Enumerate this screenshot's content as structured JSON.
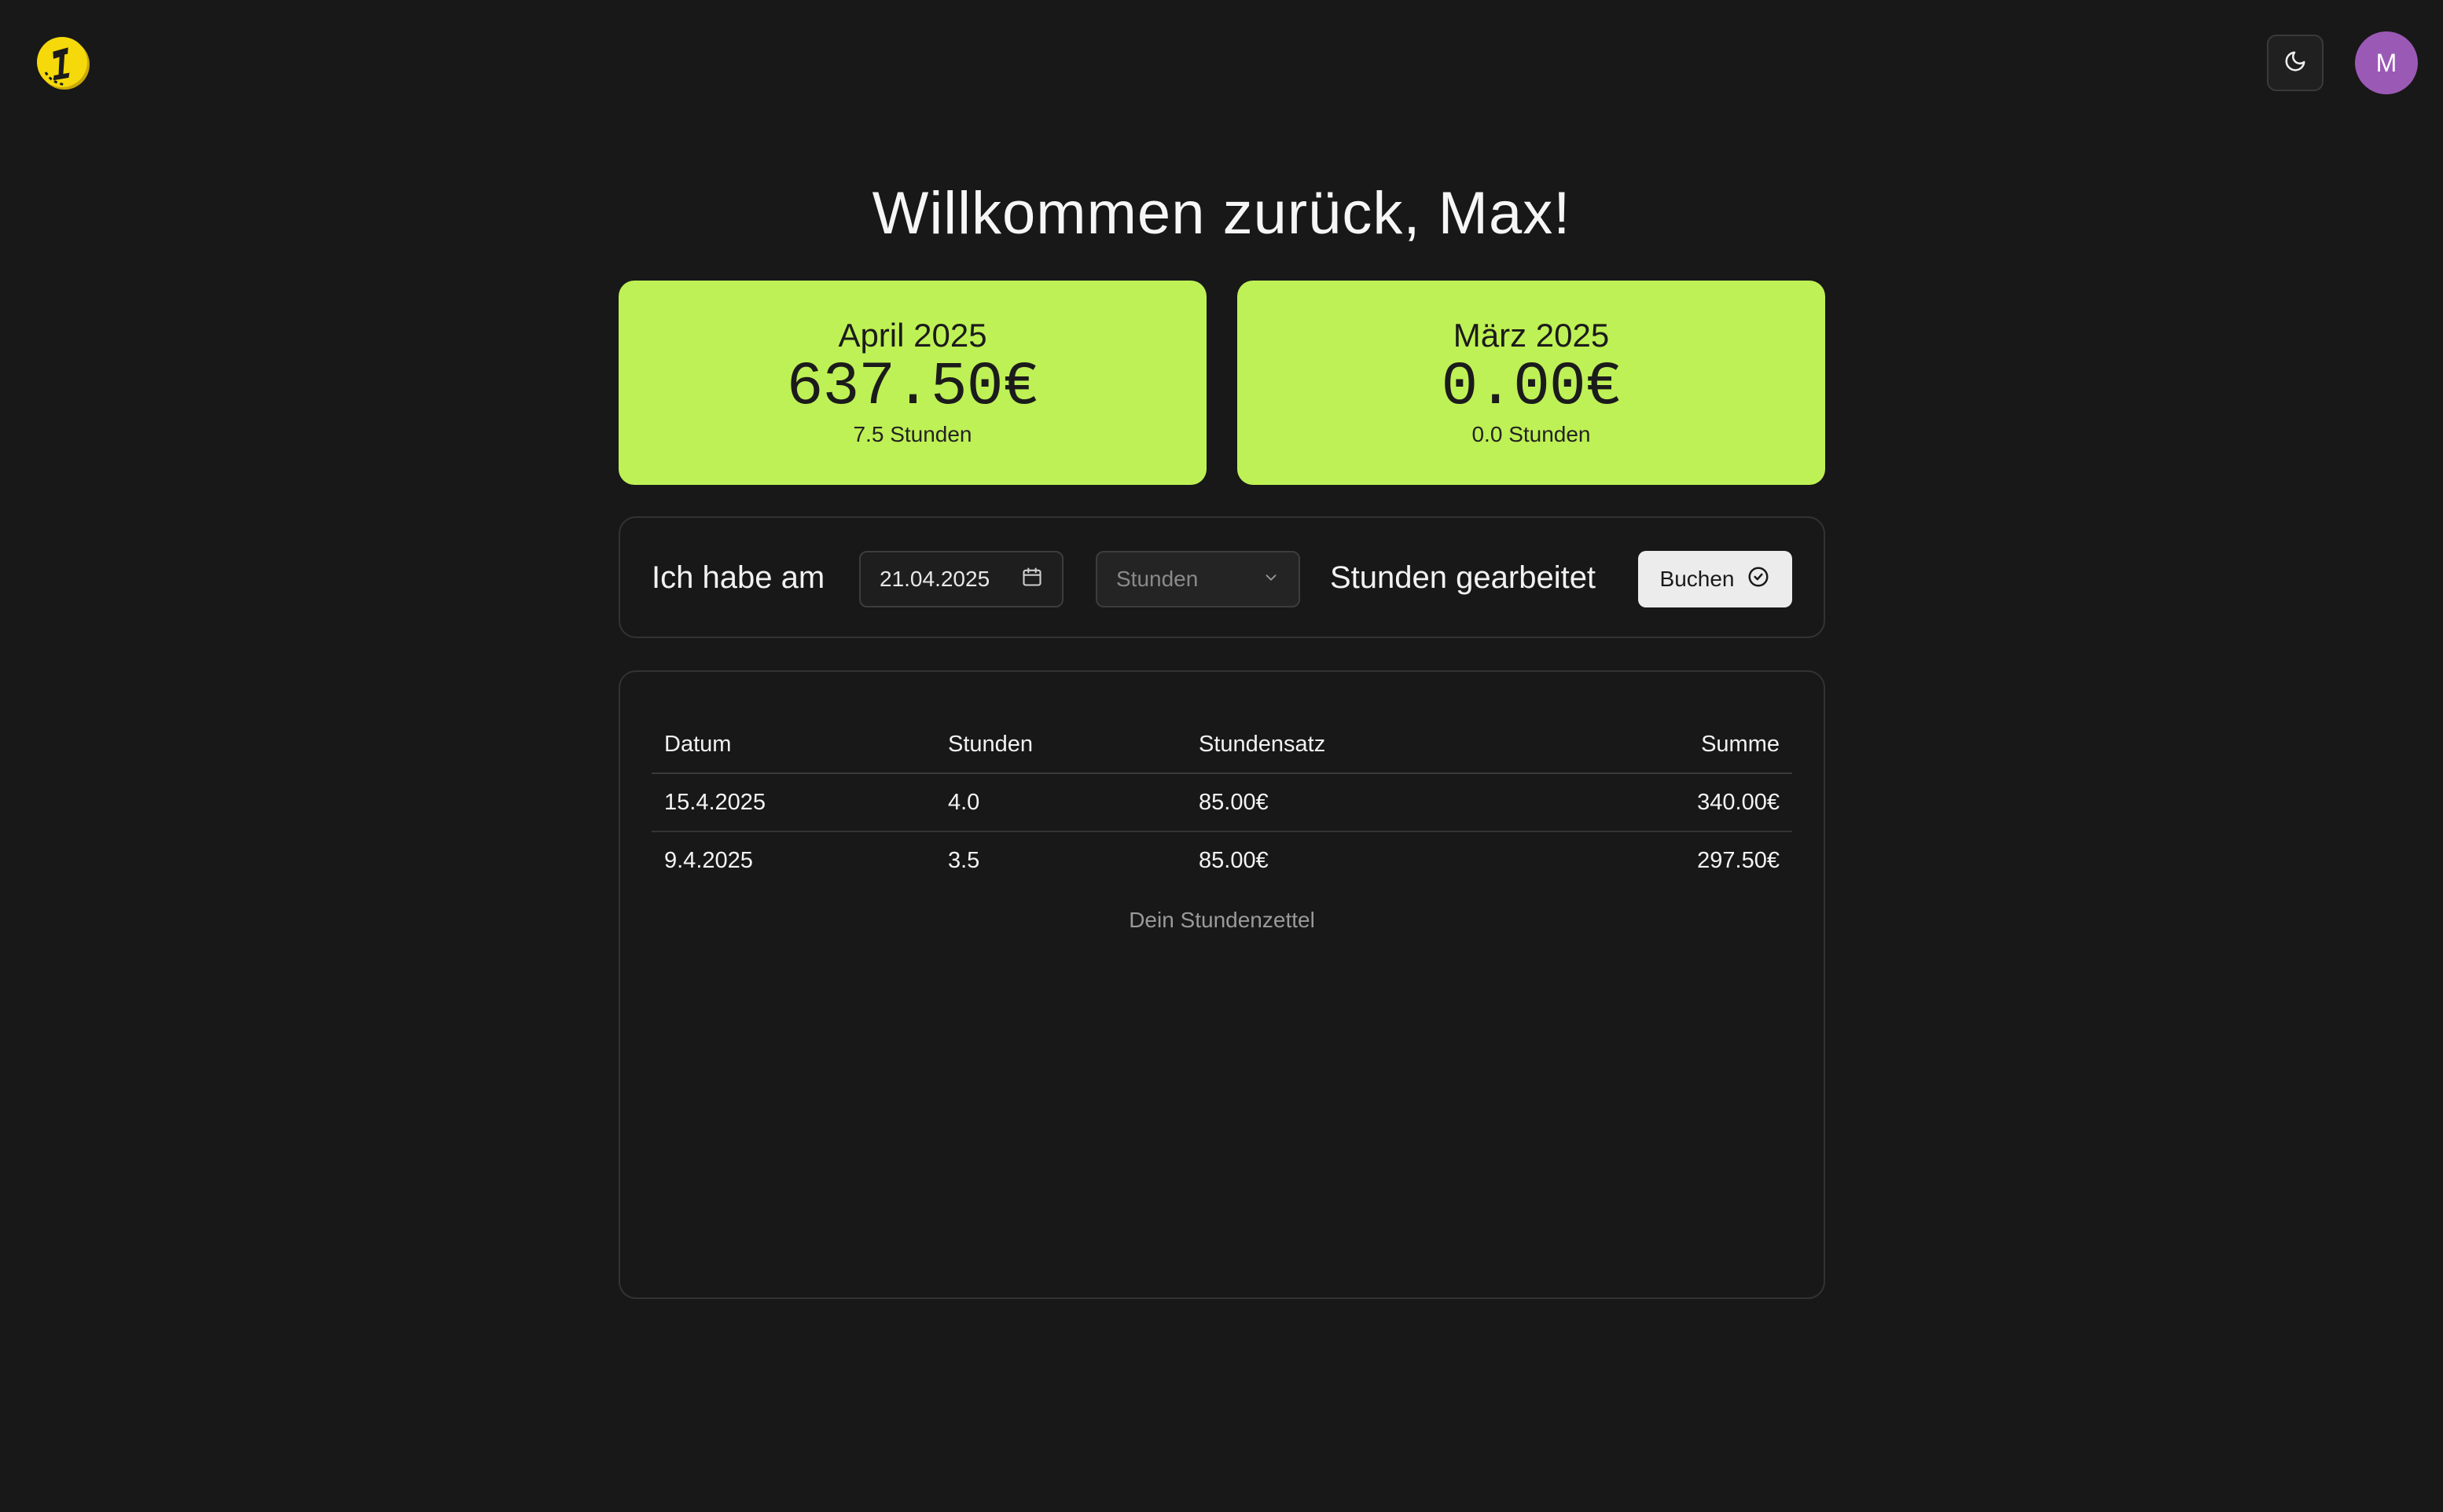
{
  "header": {
    "logo_icon": "coin-logo-icon",
    "theme_icon": "moon-icon",
    "avatar_initial": "M",
    "avatar_color": "#9b59b6"
  },
  "welcome": "Willkommen zurück, Max!",
  "summary": [
    {
      "month": "April 2025",
      "amount": "637.50€",
      "hours": "7.5 Stunden"
    },
    {
      "month": "März 2025",
      "amount": "0.00€",
      "hours": "0.0 Stunden"
    }
  ],
  "entry": {
    "prefix": "Ich habe am",
    "date_value": "21.04.2025",
    "hours_placeholder": "Stunden",
    "suffix": "Stunden gearbeitet",
    "button_label": "Buchen"
  },
  "table": {
    "columns": [
      "Datum",
      "Stunden",
      "Stundensatz",
      "Summe"
    ],
    "rows": [
      [
        "15.4.2025",
        "4.0",
        "85.00€",
        "340.00€"
      ],
      [
        "9.4.2025",
        "3.5",
        "85.00€",
        "297.50€"
      ]
    ],
    "caption": "Dein Stundenzettel"
  },
  "colors": {
    "background": "#181818",
    "card_accent": "#bef155",
    "logo_yellow": "#f5d90a"
  }
}
